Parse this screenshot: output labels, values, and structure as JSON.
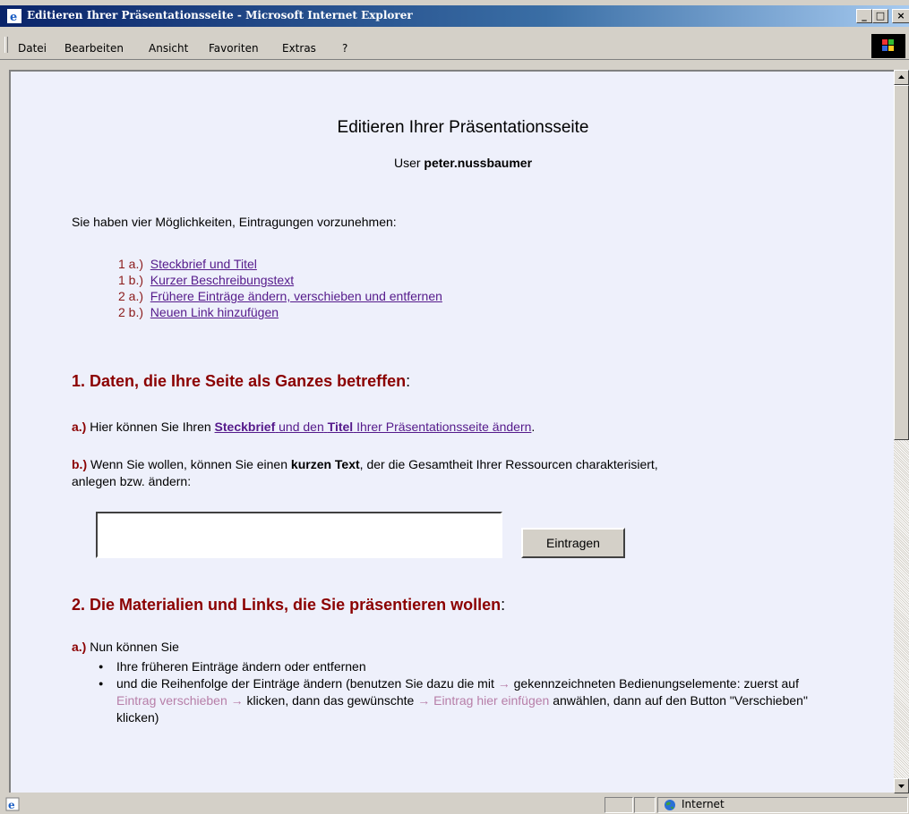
{
  "window": {
    "title": "Editieren Ihrer Präsentationsseite - Microsoft Internet Explorer",
    "minimize": "_",
    "maximize": "□",
    "close": "×"
  },
  "menu": {
    "items": [
      "Datei",
      "Bearbeiten",
      "Ansicht",
      "Favoriten",
      "Extras",
      "?"
    ]
  },
  "page": {
    "title": "Editieren Ihrer Präsentationsseite",
    "user_label": "User",
    "user_name": "peter.nussbaumer",
    "intro": "Sie haben vier Möglichkeiten, Eintragungen vorzunehmen:",
    "toc": [
      {
        "num": "1 a.)",
        "label": "Steckbrief und Titel"
      },
      {
        "num": "1 b.)",
        "label": "Kurzer Beschreibungstext"
      },
      {
        "num": "2 a.)",
        "label": "Frühere Einträge ändern, verschieben und entfernen"
      },
      {
        "num": "2 b.)",
        "label": "Neuen Link hinzufügen"
      }
    ],
    "section1": {
      "heading": "1. Daten, die Ihre Seite als Ganzes betreffen",
      "colon": ":",
      "a_label": "a.)",
      "a_text": "Hier können Sie Ihren",
      "a_link_bold1": "Steckbrief",
      "a_link_mid": "und den",
      "a_link_bold2": "Titel",
      "a_link_end": "Ihrer Präsentationsseite ändern",
      "a_period": ".",
      "b_label": "b.)",
      "b_text1": "Wenn Sie wollen, können Sie einen",
      "b_bold": "kurzen Text",
      "b_text2": ", der die Gesamtheit Ihrer Ressourcen charakterisiert,",
      "b_text3": "anlegen bzw. ändern:",
      "textarea_value": "",
      "submit_label": "Eintragen"
    },
    "section2": {
      "heading": "2. Die Materialien und Links, die Sie präsentieren wollen",
      "colon": ":",
      "a_label": "a.)",
      "a_text": "Nun können Sie",
      "bullet1": "Ihre früheren Einträge ändern oder entfernen",
      "bullet2_part1": "und die Reihenfolge der Einträge ändern (benutzen Sie dazu die mit",
      "bullet2_arrow1": "→",
      "bullet2_part2": "gekennzeichneten Bedienungselemente: zuerst auf",
      "bullet2_hint1": "Eintrag verschieben",
      "bullet2_arrow2": "→",
      "bullet2_part3": "klicken, dann das gewünschte",
      "bullet2_arrow3": "→",
      "bullet2_hint2": "Eintrag hier einfügen",
      "bullet2_part4": "anwählen, dann auf den Button \"Verschieben\" klicken)"
    }
  },
  "status": {
    "zone": "Internet"
  }
}
